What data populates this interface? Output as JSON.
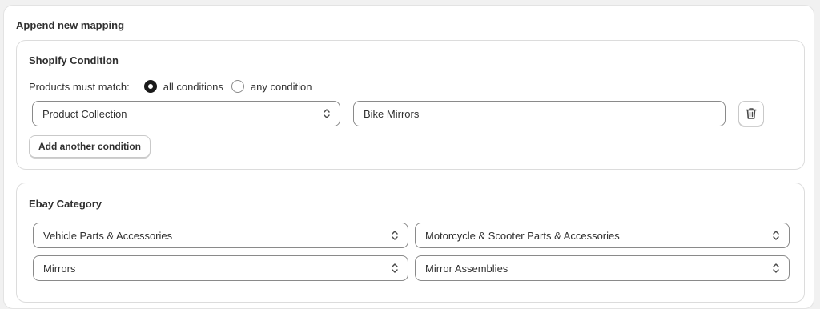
{
  "section_title": "Append new mapping",
  "shopify": {
    "title": "Shopify Condition",
    "match_label": "Products must match:",
    "option_all": "all conditions",
    "option_any": "any condition",
    "selected_option": "all conditions",
    "condition_field": "Product Collection",
    "condition_value": "Bike Mirrors",
    "add_condition_label": "Add another condition",
    "delete_icon": "trash-icon"
  },
  "ebay": {
    "title": "Ebay Category",
    "category_1": "Vehicle Parts & Accessories",
    "category_2": "Motorcycle & Scooter Parts & Accessories",
    "category_3": "Mirrors",
    "category_4": "Mirror Assemblies"
  }
}
